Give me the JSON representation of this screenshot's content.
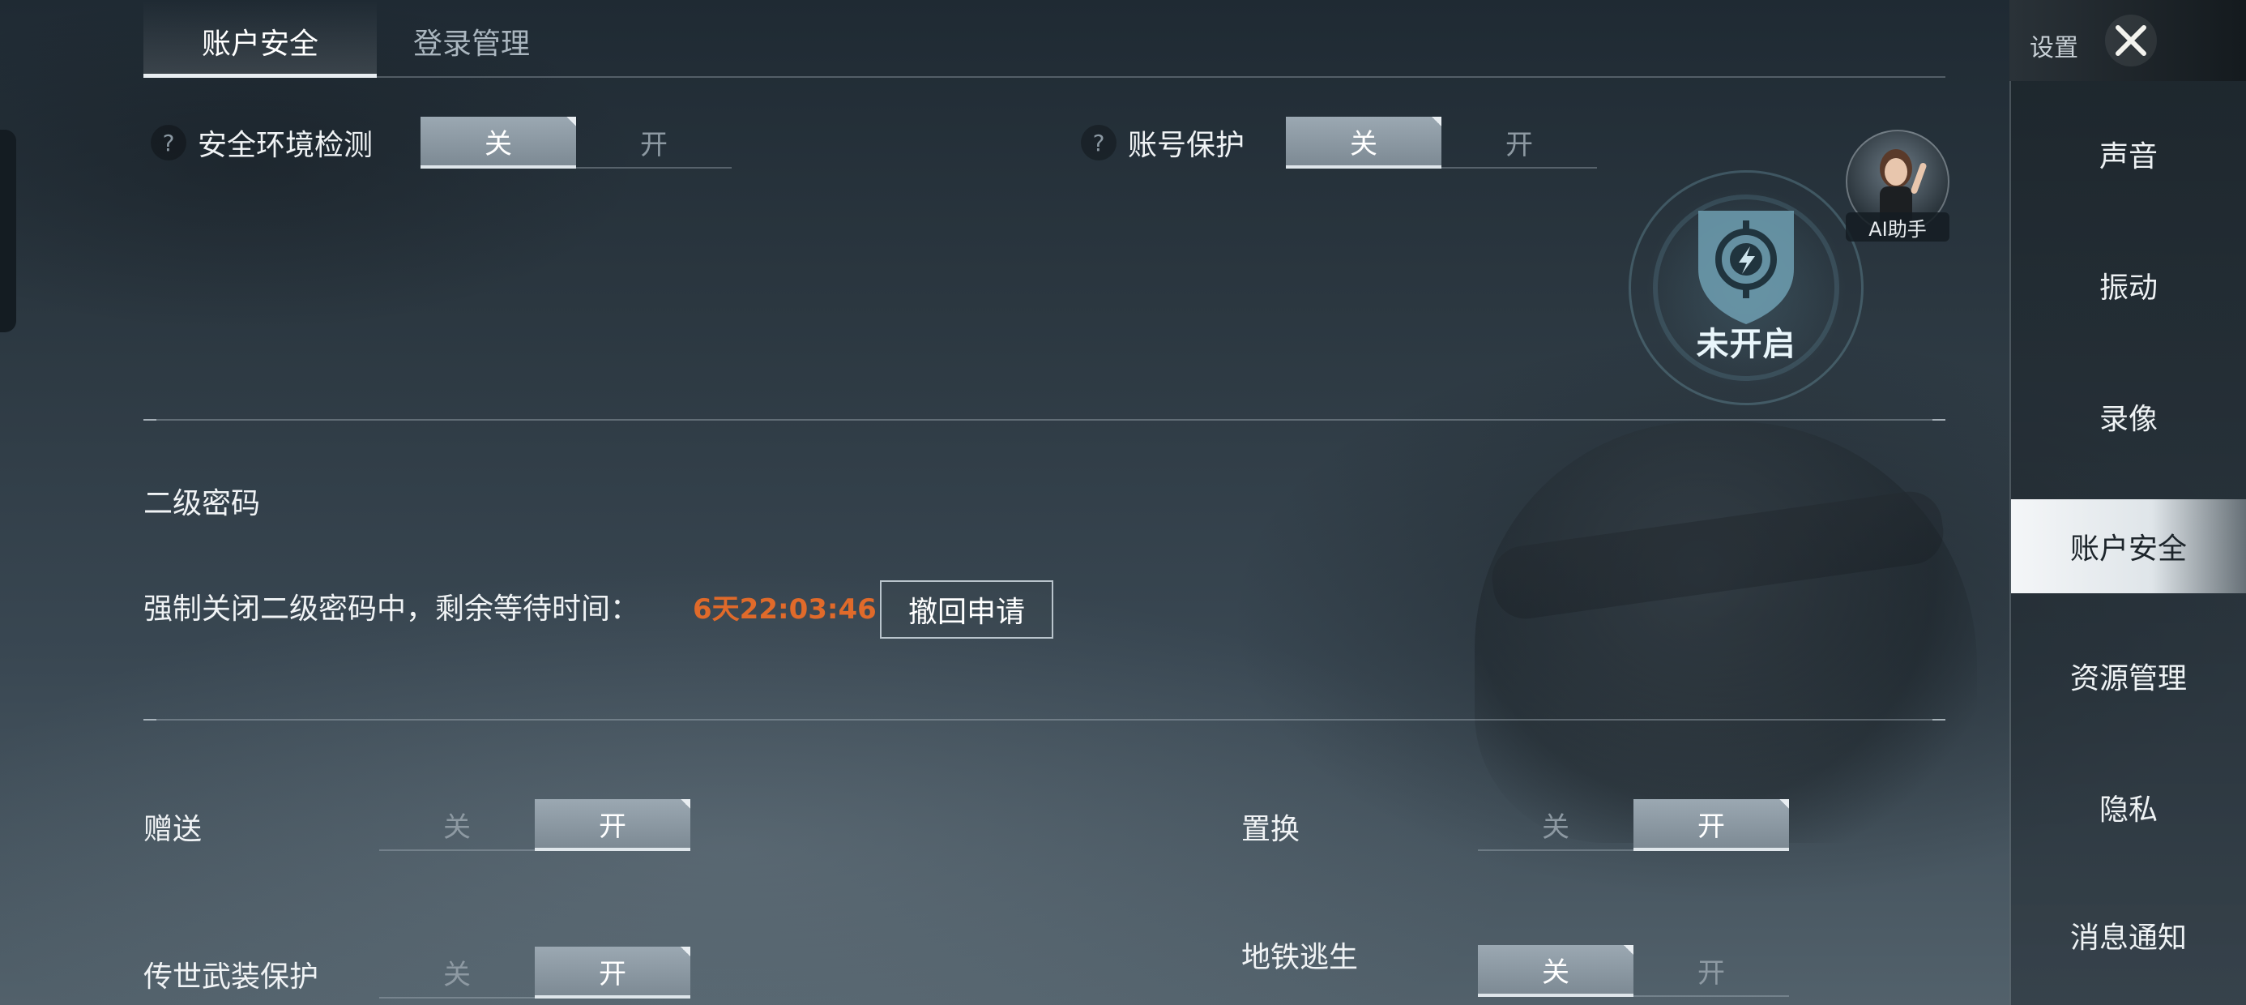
{
  "tabs": [
    {
      "label": "账户安全",
      "active": true
    },
    {
      "label": "登录管理",
      "active": false
    }
  ],
  "security_options": [
    {
      "help": "?",
      "label": "安全环境检测",
      "off_label": "关",
      "on_label": "开",
      "state": "关"
    },
    {
      "help": "?",
      "label": "账号保护",
      "off_label": "关",
      "on_label": "开",
      "state": "关"
    }
  ],
  "badge": {
    "status_text": "未开启",
    "icon": "shield-lightning-icon"
  },
  "ai_assistant": {
    "label": "AI助手"
  },
  "second_password": {
    "title": "二级密码",
    "status_text": "强制关闭二级密码中，剩余等待时间：",
    "countdown": "6天22:03:46",
    "revoke_button": "撤回申请",
    "countdown_color": "#e06a2a"
  },
  "toggles": [
    {
      "label": "赠送",
      "off_label": "关",
      "on_label": "开",
      "state": "开"
    },
    {
      "label": "置换",
      "off_label": "关",
      "on_label": "开",
      "state": "开"
    },
    {
      "label": "传世武装保护",
      "off_label": "关",
      "on_label": "开",
      "state": "开"
    },
    {
      "label": "地铁逃生",
      "off_label": "关",
      "on_label": "开",
      "state": "关"
    }
  ],
  "sidebar": {
    "title": "设置",
    "close_icon": "close-x-icon",
    "items": [
      {
        "label": "声音",
        "active": false
      },
      {
        "label": "振动",
        "active": false
      },
      {
        "label": "录像",
        "active": false
      },
      {
        "label": "账户安全",
        "active": true
      },
      {
        "label": "资源管理",
        "active": false
      },
      {
        "label": "隐私",
        "active": false
      },
      {
        "label": "消息通知",
        "active": false
      }
    ]
  },
  "colors": {
    "accent_active_toggle": "#8a97a1",
    "countdown": "#e06a2a",
    "sidebar_active": "#eef2f4"
  }
}
